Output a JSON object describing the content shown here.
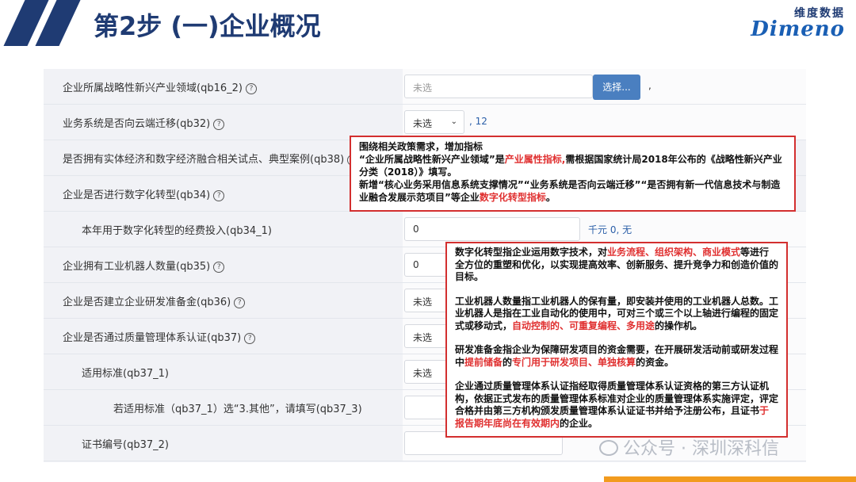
{
  "header": {
    "title": "第2步  (一)企业概况",
    "logo_cn": "维度数据",
    "logo_en": "Dimeno"
  },
  "form": {
    "rows": [
      {
        "label": "企业所属战略性新兴产业领域(qb16_2)",
        "input_placeholder": "未选",
        "button": "选择...",
        "note": ","
      },
      {
        "label": "业务系统是否向云端迁移(qb32)",
        "select_value": "未选",
        "note": ", 12"
      },
      {
        "label": "是否拥有实体经济和数字经济融合相关试点、典型案例(qb38)"
      },
      {
        "label": "企业是否进行数字化转型(qb34)"
      },
      {
        "label": "本年用于数字化转型的经费投入(qb34_1)",
        "input_value": "0",
        "note": "千元 0, 无"
      },
      {
        "label": "企业拥有工业机器人数量(qb35)",
        "input_value": "0"
      },
      {
        "label": "企业是否建立企业研发准备金(qb36)",
        "select_value": "未选"
      },
      {
        "label": "企业是否通过质量管理体系认证(qb37)",
        "select_value": "未选"
      },
      {
        "label": "适用标准(qb37_1)",
        "select_value": "未选"
      },
      {
        "label": "若适用标准（qb37_1）选“3.其他”，请填写(qb37_3)"
      },
      {
        "label": "证书编号(qb37_2)"
      }
    ],
    "help_glyph": "?"
  },
  "callout1": {
    "l1": "围绕相关政策需求，增加指标",
    "l2a": "“企业所属战略性新兴产业领域”是",
    "l2b": "产业属性指标,",
    "l2c": "需根据国家统计局2018年公布的《战略性新兴产业分类（2018）》填写。",
    "l3a": "新增“核心业务采用信息系统支撑情况”“业务系统是否向云端迁移”“是否拥有新一代信息技术与制造业融合发展示范项目”等企业",
    "l3b": "数字化转型指标",
    "l3c": "。"
  },
  "callout2": {
    "p1a": "数字化转型指企业运用数字技术，对",
    "p1b": "业务流程、组织架构、商业模式",
    "p1c": "等进行全方位的重塑和优化，以实现提高效率、创新服务、提升竞争力和创造价值的目标。",
    "p2a": "工业机器人数量指工业机器人的保有量，即安装并使用的工业机器人总数。工业机器人是指在工业自动化的使用中，可对三个或三个以上轴进行编程的固定式或移动式，",
    "p2b": "自动控制的、可重复编程、多用途",
    "p2c": "的操作机。",
    "p3a": "研发准备金指企业为保障研发项目的资金需要，在开展研发活动前或研发过程中",
    "p3b": "提前储备",
    "p3c": "的",
    "p3d": "专门用于研发项目、单独核算",
    "p3e": "的资金。",
    "p4a": "企业通过质量管理体系认证指经取得质量管理体系认证资格的第三方认证机构，依据正式发布的质量管理体系标准对企业的质量管理体系实施评定，评定合格并由第三方机构颁发质量管理体系认证证书并给予注册公布，且证书",
    "p4b": "于报告期年底尚在有效期内",
    "p4c": "的企业。"
  },
  "watermark": "公众号 · 深圳深科信",
  "colors": {
    "brand": "#1f3b73",
    "accent_red": "#e03030",
    "button": "#4a7fc0",
    "orange": "#f29b1e"
  }
}
